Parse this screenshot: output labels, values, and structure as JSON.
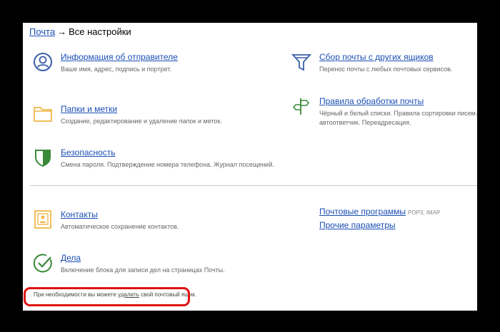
{
  "breadcrumb": {
    "root": "Почта",
    "arrow": "→",
    "current": "Все настройки"
  },
  "left_items": [
    {
      "icon": "user-circle-icon",
      "title": "Информация об отправителе",
      "desc": "Ваше имя, адрес, подпись и портрет."
    },
    {
      "icon": "folder-icon",
      "title": "Папки и метки",
      "desc": "Создание, редактирование и удаление папок и меток."
    },
    {
      "icon": "shield-icon",
      "title": "Безопасность",
      "desc": "Смена пароля. Подтверждение номера телефона. Журнал посещений."
    },
    {
      "icon": "contact-card-icon",
      "title": "Контакты",
      "desc": "Автоматическое сохранение контактов."
    },
    {
      "icon": "checkmark-circle-icon",
      "title": "Дела",
      "desc": "Включение блока для записи дел на страницах Почты."
    }
  ],
  "right_items": [
    {
      "icon": "funnel-icon",
      "title": "Сбор почты с других ящиков",
      "desc": "Перенос почты с любых почтовых сервисов."
    },
    {
      "icon": "signpost-icon",
      "title": "Правила обработки почты",
      "desc_line1": "Чёрный и белый списки. Правила сортировки писем.",
      "desc_line2": "автоответчик. Переадресация."
    }
  ],
  "right_links": {
    "mail_programs": "Почтовые программы",
    "mail_programs_note": "POP3, IMAP",
    "other_params": "Прочие параметры"
  },
  "footer": {
    "before": "При необходимости вы можете",
    "link": "удалить",
    "after": "свой почтовый ящик."
  },
  "colors": {
    "link": "#1a4fb5",
    "icon_blue": "#3b5fa8",
    "icon_orange": "#f0b84a",
    "icon_green": "#3a8a3a",
    "highlight": "#e01010"
  }
}
